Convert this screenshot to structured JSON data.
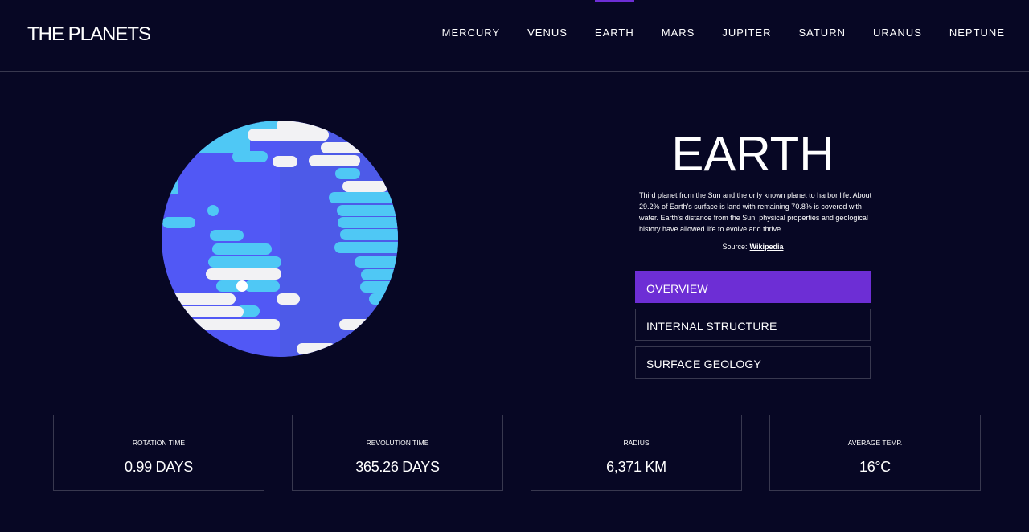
{
  "header": {
    "logo": "THE PLANETS",
    "nav": [
      {
        "label": "MERCURY",
        "active": false
      },
      {
        "label": "VENUS",
        "active": false
      },
      {
        "label": "EARTH",
        "active": true
      },
      {
        "label": "MARS",
        "active": false
      },
      {
        "label": "JUPITER",
        "active": false
      },
      {
        "label": "SATURN",
        "active": false
      },
      {
        "label": "URANUS",
        "active": false
      },
      {
        "label": "NEPTUNE",
        "active": false
      }
    ]
  },
  "planet": {
    "name": "EARTH",
    "description": "Third planet from the Sun and the only known planet to harbor life. About 29.2% of Earth's surface is land with remaining 70.8% is covered with water. Earth's distance from the Sun, physical properties and geological history have allowed life to evolve and thrive.",
    "source_prefix": "Source:",
    "source_link": "Wikipedia",
    "image_icon": "earth-illustration"
  },
  "tabs": [
    {
      "label": "OVERVIEW",
      "active": true
    },
    {
      "label": "INTERNAL STRUCTURE",
      "active": false
    },
    {
      "label": "SURFACE GEOLOGY",
      "active": false
    }
  ],
  "stats": [
    {
      "label": "ROTATION TIME",
      "value": "0.99 DAYS"
    },
    {
      "label": "REVOLUTION TIME",
      "value": "365.26 DAYS"
    },
    {
      "label": "RADIUS",
      "value": "6,371 KM"
    },
    {
      "label": "AVERAGE TEMP.",
      "value": "16°C"
    }
  ],
  "colors": {
    "background": "#070724",
    "accent": "#6d2ed5",
    "border": "#38384f",
    "ocean": "#5158f5",
    "ocean_shade": "#4d5ae8",
    "land": "#4fc8f5",
    "cloud": "#ffffff"
  }
}
